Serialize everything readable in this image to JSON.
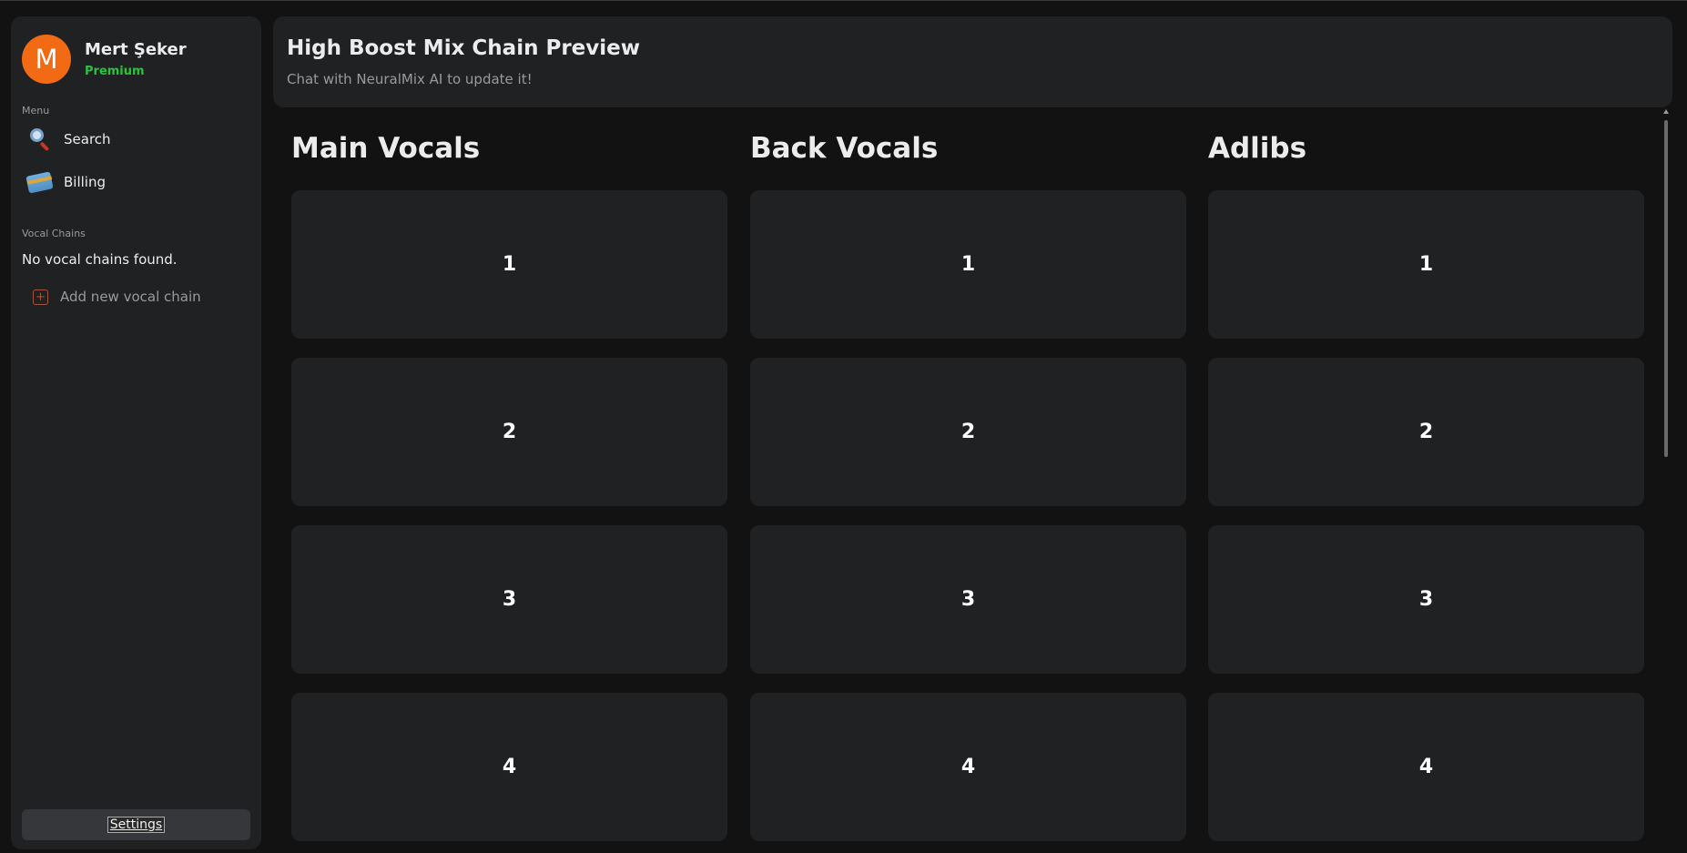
{
  "user": {
    "initial": "M",
    "name": "Mert Şeker",
    "plan": "Premium"
  },
  "sidebar": {
    "menu_label": "Menu",
    "menu_items": [
      {
        "label": "Search",
        "icon": "search-icon"
      },
      {
        "label": "Billing",
        "icon": "credit-card-icon"
      }
    ],
    "chains_label": "Vocal Chains",
    "empty_text": "No vocal chains found.",
    "add_label": "Add new vocal chain",
    "settings_label": "Settings"
  },
  "header": {
    "title": "High Boost Mix Chain Preview",
    "subtitle": "Chat with NeuralMix AI to update it!"
  },
  "columns": [
    {
      "title": "Main Vocals",
      "slots": [
        "1",
        "2",
        "3",
        "4"
      ]
    },
    {
      "title": "Back Vocals",
      "slots": [
        "1",
        "2",
        "3",
        "4"
      ]
    },
    {
      "title": "Adlibs",
      "slots": [
        "1",
        "2",
        "3",
        "4"
      ]
    }
  ],
  "colors": {
    "avatar": "#f26a13",
    "premium": "#28c43a",
    "panel": "#202123",
    "background": "#121212"
  }
}
